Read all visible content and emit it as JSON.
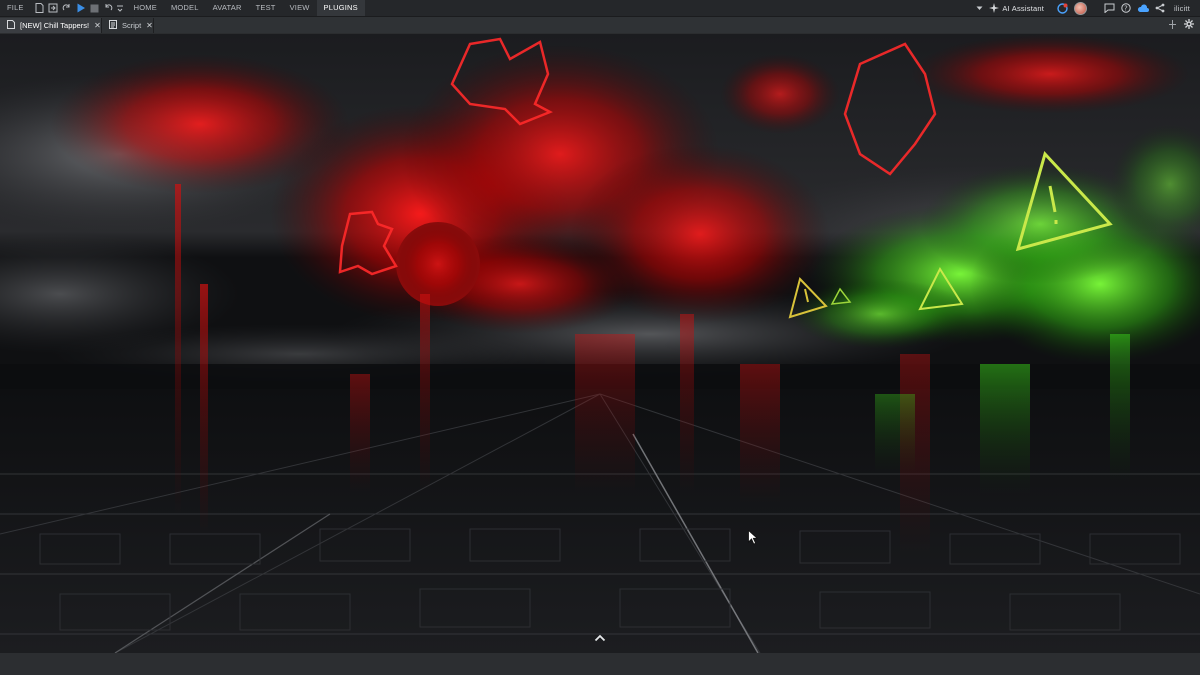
{
  "menu": {
    "file": "FILE",
    "tabs": [
      "HOME",
      "MODEL",
      "AVATAR",
      "TEST",
      "VIEW",
      "PLUGINS"
    ],
    "active_tab": "PLUGINS"
  },
  "toolbar_right": {
    "ai_assistant_label": "AI Assistant",
    "username": "ilicitt"
  },
  "document_tabs": [
    {
      "label": "[NEW] Chill Tappers!",
      "icon": "place-icon",
      "close": "✕",
      "active": true
    },
    {
      "label": "Script",
      "icon": "script-icon",
      "close": "✕",
      "active": false
    }
  ],
  "viewport": {
    "collapse_icon": "chevron-up-icon",
    "scene": "red and green smoky sky over dark tiled floor"
  },
  "colors": {
    "toolbar_bg": "#25272a",
    "tab_active": "#3a3d41",
    "accent_play": "#3a8ee6",
    "smoke_red": "#e01414",
    "smoke_green": "#5cff2a"
  }
}
